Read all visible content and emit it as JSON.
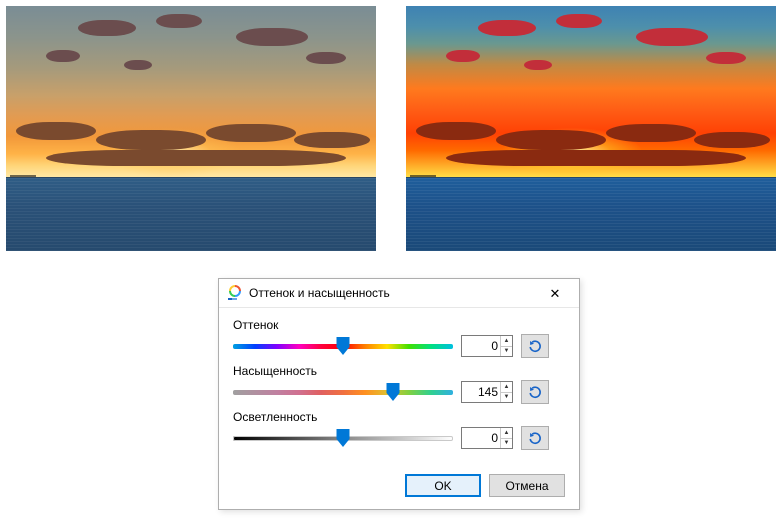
{
  "previews": {
    "left_label": "original-sunset-preview",
    "right_label": "saturated-sunset-preview"
  },
  "dialog": {
    "title": "Оттенок и насыщенность",
    "close_glyph": "✕",
    "rows": {
      "hue": {
        "label": "Оттенок",
        "value": "0",
        "min": -180,
        "max": 180,
        "thumb_percent": 50
      },
      "saturation": {
        "label": "Насыщенность",
        "value": "145",
        "min": 0,
        "max": 200,
        "thumb_percent": 72.5
      },
      "lightness": {
        "label": "Осветленность",
        "value": "0",
        "min": -100,
        "max": 100,
        "thumb_percent": 50
      }
    },
    "buttons": {
      "ok": "OK",
      "cancel": "Отмена"
    },
    "icons": {
      "reset_arrow": "↺",
      "step_up": "▲",
      "step_down": "▼"
    }
  }
}
